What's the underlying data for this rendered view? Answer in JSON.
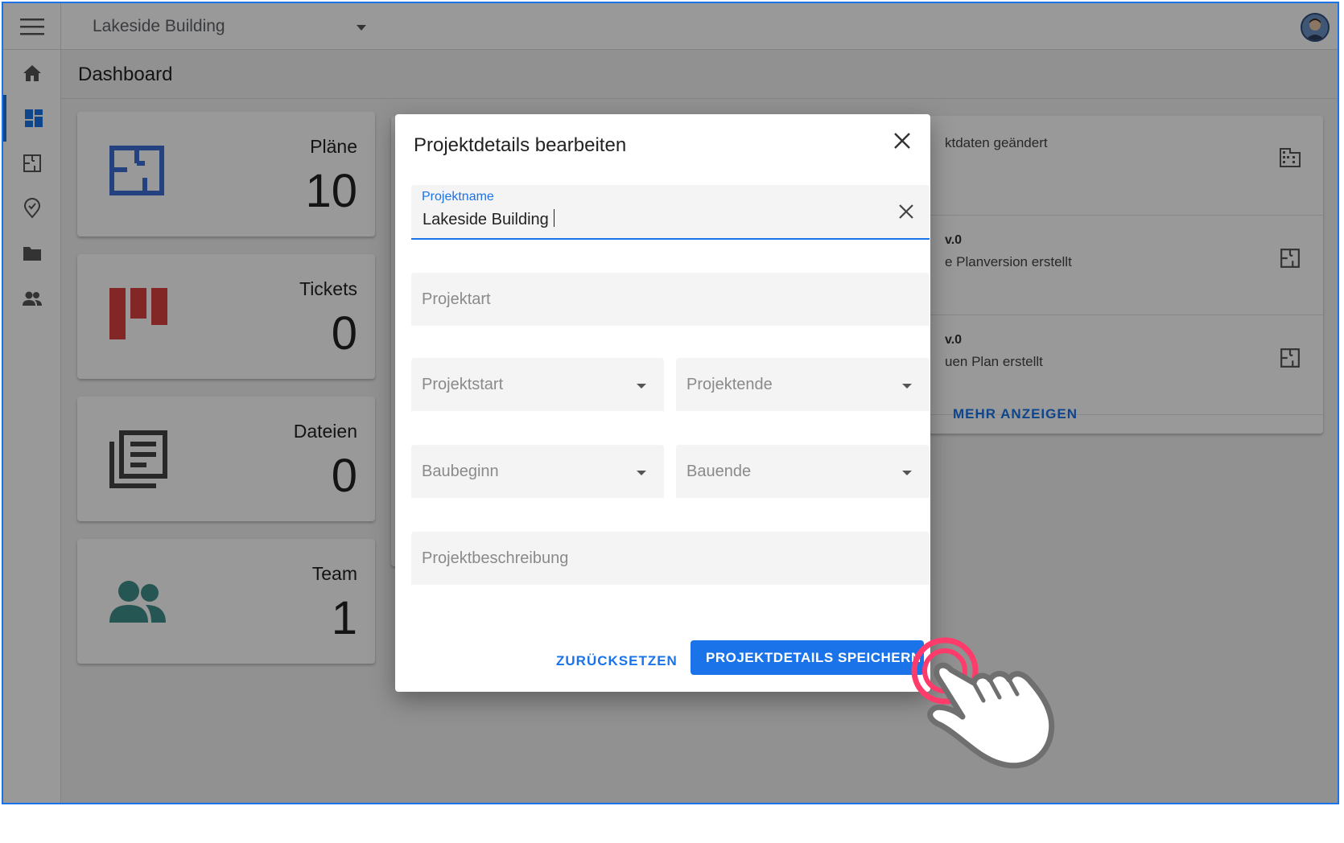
{
  "topbar": {
    "project_name": "Lakeside Building"
  },
  "page": {
    "title": "Dashboard"
  },
  "sidebar": {
    "items": [
      "home-icon",
      "dashboard-icon",
      "plan-icon",
      "location-check-icon",
      "folder-icon",
      "team-icon"
    ],
    "active_index": 1
  },
  "stats": [
    {
      "label": "Pläne",
      "value": "10",
      "icon": "plan-icon",
      "color": "#3f6fd6"
    },
    {
      "label": "Tickets",
      "value": "0",
      "icon": "tickets-icon",
      "color": "#d94040"
    },
    {
      "label": "Dateien",
      "value": "0",
      "icon": "files-icon",
      "color": "#444444"
    },
    {
      "label": "Team",
      "value": "1",
      "icon": "team-icon",
      "color": "#3f8f8a"
    }
  ],
  "activity": {
    "items": [
      {
        "title": "",
        "desc": "ktdaten geändert",
        "icon": "building-icon"
      },
      {
        "title": "v.0",
        "desc": "e Planversion erstellt",
        "icon": "plan-icon"
      },
      {
        "title": "v.0",
        "desc": "uen Plan erstellt",
        "icon": "plan-icon"
      }
    ],
    "show_more": "MEHR ANZEIGEN"
  },
  "dialog": {
    "title": "Projektdetails bearbeiten",
    "name_label": "Projektname",
    "name_value": "Lakeside Building",
    "project_type_placeholder": "Projektart",
    "project_start_placeholder": "Projektstart",
    "project_end_placeholder": "Projektende",
    "construction_start_placeholder": "Baubeginn",
    "construction_end_placeholder": "Bauende",
    "description_placeholder": "Projektbeschreibung",
    "reset_label": "ZURÜCKSETZEN",
    "save_label": "PROJEKTDETAILS SPEICHERN"
  },
  "colors": {
    "accent": "#1a73e8",
    "click_indicator": "#ff3b6b"
  }
}
